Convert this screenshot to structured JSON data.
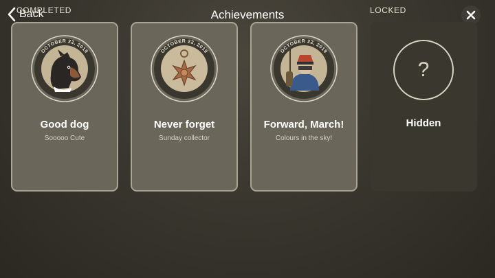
{
  "header": {
    "back_label": "Back",
    "completed_label": "COMPLETED",
    "title": "Achievements",
    "locked_label": "LOCKED"
  },
  "cards": [
    {
      "date": "OCTOBER 22, 2019",
      "title": "Good dog",
      "subtitle": "Sooooo Cute",
      "icon": "dog-portrait-icon"
    },
    {
      "date": "OCTOBER 22, 2019",
      "title": "Never forget",
      "subtitle": "Sunday collector",
      "icon": "war-cross-medal-icon"
    },
    {
      "date": "OCTOBER 22, 2019",
      "title": "Forward, March!",
      "subtitle": "Colours in the sky!",
      "icon": "soldier-portrait-icon"
    },
    {
      "title": "Hidden",
      "glyph": "?",
      "icon": "question-mark-icon"
    }
  ],
  "colors": {
    "background": "#3a372f",
    "card": "#6b665a",
    "card_border": "#a9a493",
    "locked_card": "#3a372f"
  }
}
